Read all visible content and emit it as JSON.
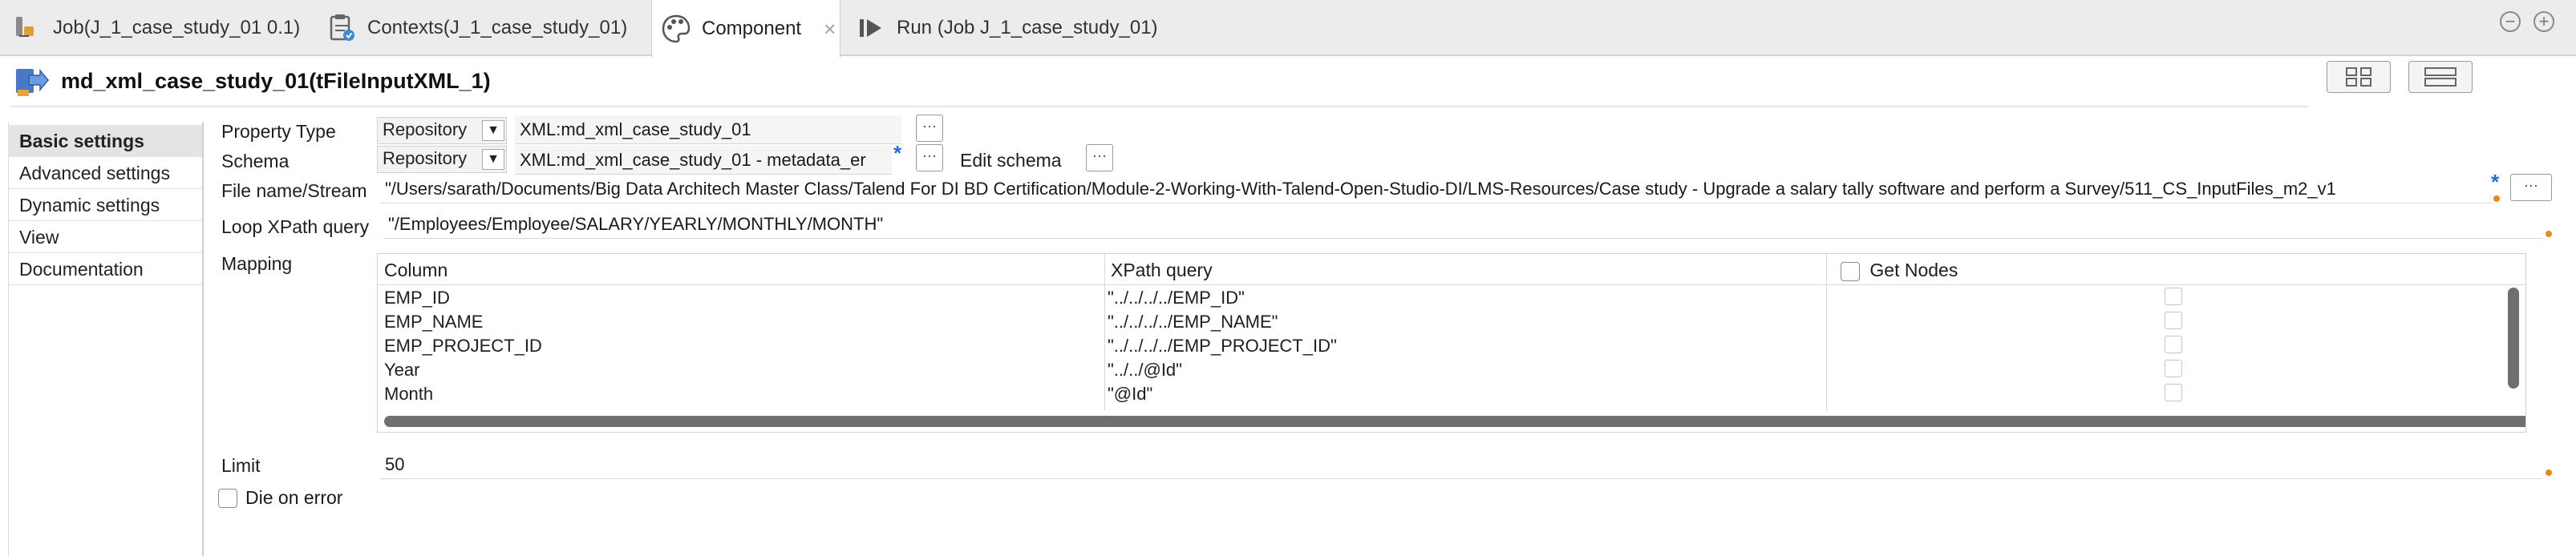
{
  "tabs": [
    {
      "label": "Job(J_1_case_study_01 0.1)",
      "icon": "job-icon",
      "active": false
    },
    {
      "label": "Contexts(J_1_case_study_01)",
      "icon": "contexts-icon",
      "active": false
    },
    {
      "label": "Component",
      "icon": "component-palette-icon",
      "active": true
    },
    {
      "label": "Run (Job J_1_case_study_01)",
      "icon": "run-icon",
      "active": false
    }
  ],
  "window_controls": {
    "minimize": "−",
    "maximize": "+"
  },
  "header": {
    "title": "md_xml_case_study_01(tFileInputXML_1)",
    "icon": "component-arrow-icon"
  },
  "sidenav": {
    "items": [
      {
        "label": "Basic settings",
        "active": true
      },
      {
        "label": "Advanced settings"
      },
      {
        "label": "Dynamic settings"
      },
      {
        "label": "View"
      },
      {
        "label": "Documentation"
      }
    ]
  },
  "form": {
    "property_type": {
      "label": "Property Type",
      "combo": "Repository",
      "value": "XML:md_xml_case_study_01"
    },
    "schema": {
      "label": "Schema",
      "combo": "Repository",
      "value": "XML:md_xml_case_study_01 - metadata_er",
      "edit_label": "Edit schema",
      "star": "*"
    },
    "file": {
      "label": "File name/Stream",
      "value": "\"/Users/sarath/Documents/Big Data Architech Master Class/Talend For DI BD Certification/Module-2-Working-With-Talend-Open-Studio-DI/LMS-Resources/Case study - Upgrade a salary tally software and perform a Survey/511_CS_InputFiles_m2_v1",
      "star": "*"
    },
    "loop_xpath": {
      "label": "Loop XPath query",
      "value": "\"/Employees/Employee/SALARY/YEARLY/MONTHLY/MONTH\""
    },
    "mapping": {
      "label": "Mapping"
    },
    "limit": {
      "label": "Limit",
      "value": "50"
    },
    "die_on_error": {
      "label": "Die on error",
      "checked": false
    },
    "dots": "···"
  },
  "mapping_table": {
    "columns": [
      "Column",
      "XPath query",
      "Get Nodes"
    ],
    "rows": [
      {
        "column": "EMP_ID",
        "xpath": "\"../../../../EMP_ID\""
      },
      {
        "column": "EMP_NAME",
        "xpath": "\"../../../../EMP_NAME\""
      },
      {
        "column": "EMP_PROJECT_ID",
        "xpath": "\"../../../../EMP_PROJECT_ID\""
      },
      {
        "column": "Year",
        "xpath": "\"../../@Id\""
      },
      {
        "column": "Month",
        "xpath": "\"@Id\""
      }
    ]
  },
  "colors": {
    "accent_blue": "#1e6fd9",
    "warning_orange": "#e88a1a",
    "header_icon_blue": "#4a78c2"
  }
}
